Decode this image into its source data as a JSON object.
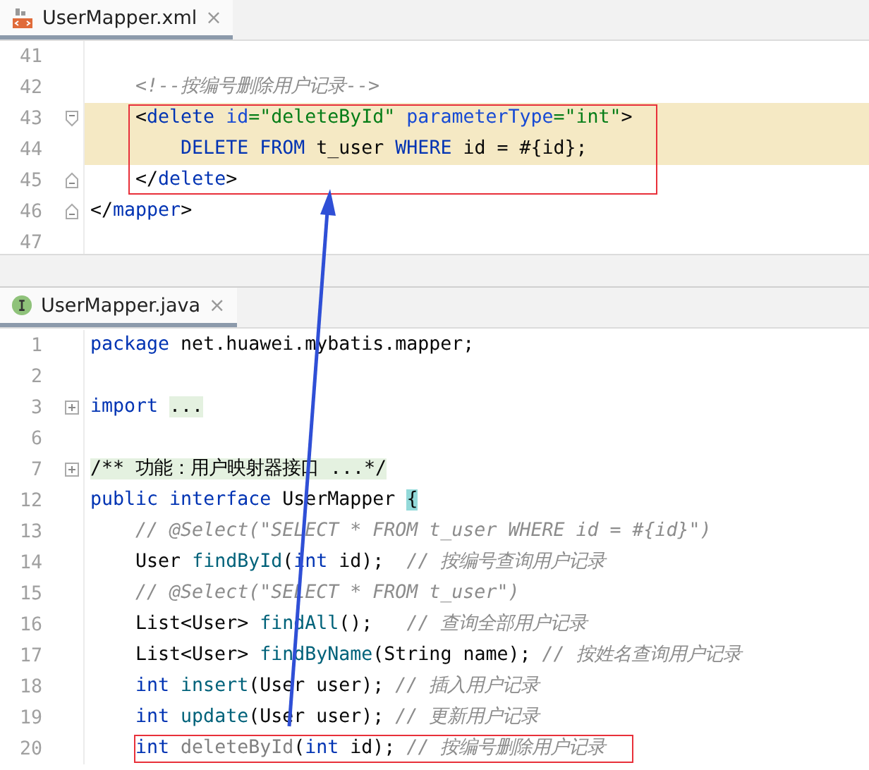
{
  "editors": [
    {
      "tab": {
        "label": "UserMapper.xml",
        "kind": "xml",
        "selected": true,
        "close": "×"
      },
      "lines": [
        {
          "number": "41"
        },
        {
          "number": "42",
          "tokens": [
            {
              "kind": "comment",
              "text": "    <!--按编号删除用户记录-->"
            }
          ]
        },
        {
          "number": "43",
          "fold": {
            "kind": "open"
          },
          "highlighted": true,
          "outlined": true,
          "tokens": [
            {
              "kind": "plain",
              "text": "    <"
            },
            {
              "kind": "tag",
              "text": "delete "
            },
            {
              "kind": "attr",
              "text": "id"
            },
            {
              "kind": "str",
              "text": "=\"deleteById\" "
            },
            {
              "kind": "attr",
              "text": "parameterType"
            },
            {
              "kind": "str",
              "text": "=\"int\""
            },
            {
              "kind": "plain",
              "text": ">"
            }
          ]
        },
        {
          "number": "44",
          "highlighted": true,
          "outlined": true,
          "tokens": [
            {
              "kind": "kw",
              "text": "        DELETE "
            },
            {
              "kind": "kw",
              "text": "FROM"
            },
            {
              "kind": "plain",
              "text": " t_user "
            },
            {
              "kind": "kw",
              "text": "WHERE"
            },
            {
              "kind": "plain",
              "text": " id = #{id};"
            }
          ]
        },
        {
          "number": "45",
          "fold": {
            "kind": "close"
          },
          "highlighted": false,
          "outlined": true,
          "tokens": [
            {
              "kind": "plain",
              "text": "    </"
            },
            {
              "kind": "tag",
              "text": "delete"
            },
            {
              "kind": "plain",
              "text": ">"
            }
          ]
        },
        {
          "number": "46",
          "fold": {
            "kind": "close"
          },
          "tokens": [
            {
              "kind": "plain",
              "text": "</"
            },
            {
              "kind": "tag",
              "text": "mapper"
            },
            {
              "kind": "plain",
              "text": ">"
            }
          ]
        },
        {
          "number": "47"
        }
      ]
    },
    {
      "tab": {
        "label": "UserMapper.java",
        "kind": "interface",
        "selected": true,
        "close": "×"
      },
      "lines": [
        {
          "number": "1",
          "tokens": [
            {
              "kind": "kw",
              "text": "package"
            },
            {
              "kind": "plain",
              "text": " net.huawei.mybatis.mapper;"
            }
          ]
        },
        {
          "number": "2"
        },
        {
          "number": "3",
          "fold": {
            "kind": "collapsed"
          },
          "tokens": [
            {
              "kind": "kw",
              "text": "import "
            },
            {
              "kind": "folded",
              "text": "..."
            }
          ]
        },
        {
          "number": "6"
        },
        {
          "number": "7",
          "fold": {
            "kind": "collapsed"
          },
          "tokens": [
            {
              "kind": "folded",
              "text": "/** 功能：用户映射器接口 ...*/"
            }
          ]
        },
        {
          "number": "12",
          "tokens": [
            {
              "kind": "kw",
              "text": "public "
            },
            {
              "kind": "kw",
              "text": "interface"
            },
            {
              "kind": "plain",
              "text": " UserMapper "
            },
            {
              "kind": "brace",
              "text": "{"
            }
          ]
        },
        {
          "number": "13",
          "tokens": [
            {
              "kind": "comment",
              "text": "    // @Select(\"SELECT * FROM t_user WHERE id = #{id}\")"
            }
          ]
        },
        {
          "number": "14",
          "tokens": [
            {
              "kind": "plain",
              "text": "    User "
            },
            {
              "kind": "method",
              "text": "findById"
            },
            {
              "kind": "plain",
              "text": "("
            },
            {
              "kind": "kw",
              "text": "int"
            },
            {
              "kind": "plain",
              "text": " id);  "
            },
            {
              "kind": "comment",
              "text": "// 按编号查询用户记录"
            }
          ]
        },
        {
          "number": "15",
          "tokens": [
            {
              "kind": "comment",
              "text": "    // @Select(\"SELECT * FROM t_user\")"
            }
          ]
        },
        {
          "number": "16",
          "tokens": [
            {
              "kind": "plain",
              "text": "    List<User> "
            },
            {
              "kind": "method",
              "text": "findAll"
            },
            {
              "kind": "plain",
              "text": "();   "
            },
            {
              "kind": "comment",
              "text": "// 查询全部用户记录"
            }
          ]
        },
        {
          "number": "17",
          "tokens": [
            {
              "kind": "plain",
              "text": "    List<User> "
            },
            {
              "kind": "method",
              "text": "findByName"
            },
            {
              "kind": "plain",
              "text": "(String name); "
            },
            {
              "kind": "comment",
              "text": "// 按姓名查询用户记录"
            }
          ]
        },
        {
          "number": "18",
          "tokens": [
            {
              "kind": "kw",
              "text": "    int "
            },
            {
              "kind": "method",
              "text": "insert"
            },
            {
              "kind": "plain",
              "text": "(User user); "
            },
            {
              "kind": "comment",
              "text": "// 插入用户记录"
            }
          ]
        },
        {
          "number": "19",
          "tokens": [
            {
              "kind": "kw",
              "text": "    int "
            },
            {
              "kind": "method",
              "text": "update"
            },
            {
              "kind": "plain",
              "text": "(User user); "
            },
            {
              "kind": "comment",
              "text": "// 更新用户记录"
            }
          ]
        },
        {
          "number": "20",
          "outlined": true,
          "tokens": [
            {
              "kind": "kw",
              "text": "    int "
            },
            {
              "kind": "unused",
              "text": "deleteById"
            },
            {
              "kind": "plain",
              "text": "("
            },
            {
              "kind": "kw",
              "text": "int"
            },
            {
              "kind": "plain",
              "text": " id); "
            },
            {
              "kind": "comment",
              "text": "// 按编号删除用户记录"
            }
          ]
        }
      ]
    }
  ]
}
